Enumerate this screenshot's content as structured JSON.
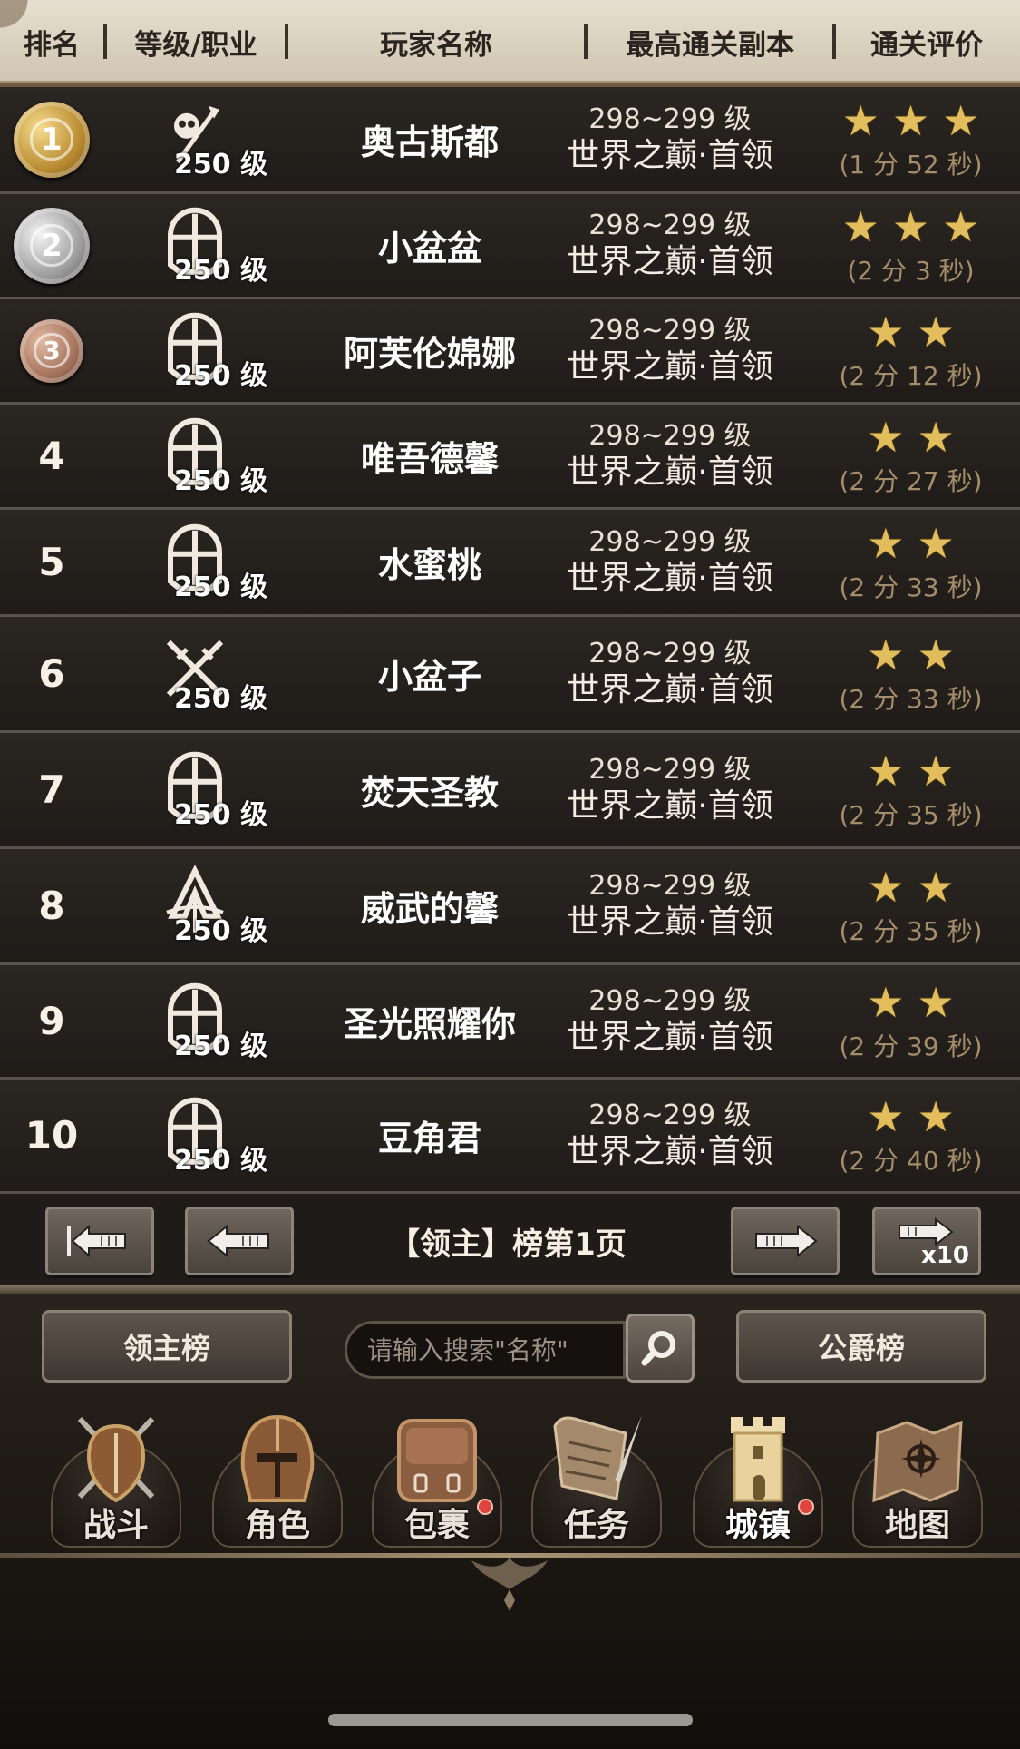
{
  "header": {
    "col_rank": "排名",
    "col_level_class": "等级/职业",
    "col_player": "玩家名称",
    "col_dungeon": "最高通关副本",
    "col_rating": "通关评价"
  },
  "rows": [
    {
      "rank": "1",
      "medal": "gold",
      "class_icon": "skull-staff-icon",
      "level": "250 级",
      "name": "奥古斯都",
      "dungeon_level": "298~299 级",
      "dungeon": "世界之巅·首领",
      "stars": 3,
      "time": "(1 分 52 秒)"
    },
    {
      "rank": "2",
      "medal": "silver",
      "class_icon": "cross-shield-icon",
      "level": "250 级",
      "name": "小盆盆",
      "dungeon_level": "298~299 级",
      "dungeon": "世界之巅·首领",
      "stars": 3,
      "time": "(2 分 3 秒)"
    },
    {
      "rank": "3",
      "medal": "bronze",
      "class_icon": "cross-shield-icon",
      "level": "250 级",
      "name": "阿芙伦婂娜",
      "dungeon_level": "298~299 级",
      "dungeon": "世界之巅·首领",
      "stars": 2,
      "time": "(2 分 12 秒)"
    },
    {
      "rank": "4",
      "medal": "",
      "class_icon": "cross-shield-icon",
      "level": "250 级",
      "name": "唯吾德馨",
      "dungeon_level": "298~299 级",
      "dungeon": "世界之巅·首领",
      "stars": 2,
      "time": "(2 分 27 秒)"
    },
    {
      "rank": "5",
      "medal": "",
      "class_icon": "cross-shield-icon",
      "level": "250 级",
      "name": "水蜜桃",
      "dungeon_level": "298~299 级",
      "dungeon": "世界之巅·首领",
      "stars": 2,
      "time": "(2 分 33 秒)"
    },
    {
      "rank": "6",
      "medal": "",
      "class_icon": "crossed-swords-icon",
      "level": "250 级",
      "name": "小盆子",
      "dungeon_level": "298~299 级",
      "dungeon": "世界之巅·首领",
      "stars": 2,
      "time": "(2 分 33 秒)"
    },
    {
      "rank": "7",
      "medal": "",
      "class_icon": "cross-shield-icon",
      "level": "250 级",
      "name": "焚天圣教",
      "dungeon_level": "298~299 级",
      "dungeon": "世界之巅·首领",
      "stars": 2,
      "time": "(2 分 35 秒)"
    },
    {
      "rank": "8",
      "medal": "",
      "class_icon": "hooded-archer-icon",
      "level": "250 级",
      "name": "威武的馨",
      "dungeon_level": "298~299 级",
      "dungeon": "世界之巅·首领",
      "stars": 2,
      "time": "(2 分 35 秒)"
    },
    {
      "rank": "9",
      "medal": "",
      "class_icon": "cross-shield-icon",
      "level": "250 级",
      "name": "圣光照耀你",
      "dungeon_level": "298~299 级",
      "dungeon": "世界之巅·首领",
      "stars": 2,
      "time": "(2 分 39 秒)"
    },
    {
      "rank": "10",
      "medal": "",
      "class_icon": "cross-shield-icon",
      "level": "250 级",
      "name": "豆角君",
      "dungeon_level": "298~299 级",
      "dungeon": "世界之巅·首领",
      "stars": 2,
      "time": "(2 分 40 秒)"
    }
  ],
  "pager": {
    "title": "【领主】榜第1页",
    "skip_label": "x10",
    "first_icon": "first-page-arrow-icon",
    "prev_icon": "prev-page-arrow-icon",
    "next_icon": "next-page-arrow-icon",
    "skip_icon": "skip-ten-arrow-icon"
  },
  "search": {
    "lord_rank_label": "领主榜",
    "placeholder": "请输入搜索\"名称\"",
    "duke_rank_label": "公爵榜",
    "search_icon": "magnifier-icon"
  },
  "nav": [
    {
      "label": "战斗",
      "icon": "shield-swords-icon",
      "badge": false,
      "active": false
    },
    {
      "label": "角色",
      "icon": "helmet-icon",
      "badge": false,
      "active": false
    },
    {
      "label": "包裹",
      "icon": "backpack-icon",
      "badge": true,
      "active": false
    },
    {
      "label": "任务",
      "icon": "scroll-quill-icon",
      "badge": false,
      "active": false
    },
    {
      "label": "城镇",
      "icon": "castle-tower-icon",
      "badge": true,
      "active": true
    },
    {
      "label": "地图",
      "icon": "map-icon",
      "badge": false,
      "active": false
    }
  ],
  "colors": {
    "star": "#e2bd5c",
    "time": "#a58d69",
    "badge": "#e0443f",
    "header_bg": "#e7dfd0"
  }
}
